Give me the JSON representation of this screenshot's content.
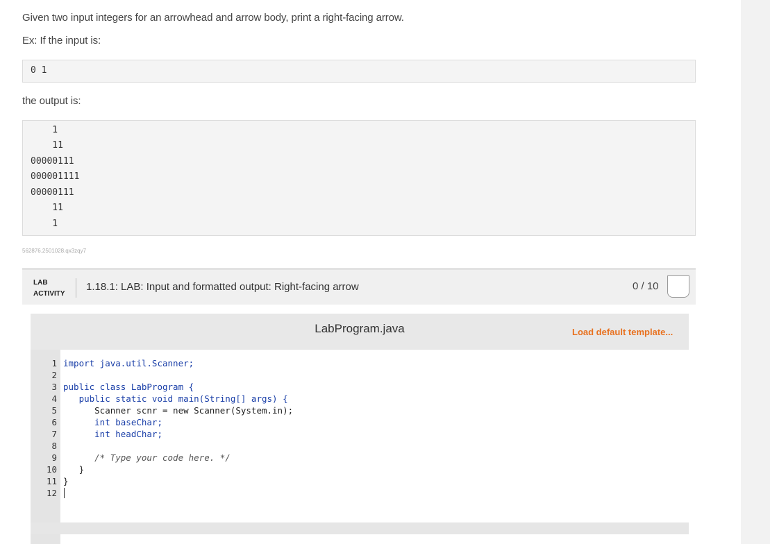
{
  "description": {
    "intro": "Given two input integers for an arrowhead and arrow body, print a right-facing arrow.",
    "example_label": "Ex: If the input is:",
    "input_example": "0 1",
    "output_label": "the output is:",
    "output_lines": [
      "    1",
      "    11",
      "00000111",
      "000001111",
      "00000111",
      "    11",
      "    1"
    ],
    "problem_id": "562876.2501028.qx3zqy7"
  },
  "lab": {
    "tag_line1": "LAB",
    "tag_line2": "ACTIVITY",
    "title": "1.18.1: LAB: Input and formatted output: Right-facing arrow",
    "score": "0 / 10"
  },
  "editor": {
    "filename": "LabProgram.java",
    "load_template": "Load default template...",
    "line_numbers": [
      "1",
      "2",
      "3",
      "4",
      "5",
      "6",
      "7",
      "8",
      "9",
      "10",
      "11",
      "12"
    ],
    "code_lines": [
      "import java.util.Scanner;",
      "",
      "public class LabProgram {",
      "   public static void main(String[] args) {",
      "      Scanner scnr = new Scanner(System.in);",
      "      int baseChar;",
      "      int headChar;",
      "",
      "      /* Type your code here. */",
      "   }",
      "}",
      ""
    ]
  },
  "colors": {
    "accent": "#e8711f",
    "keyword": "#1a3fa8"
  }
}
